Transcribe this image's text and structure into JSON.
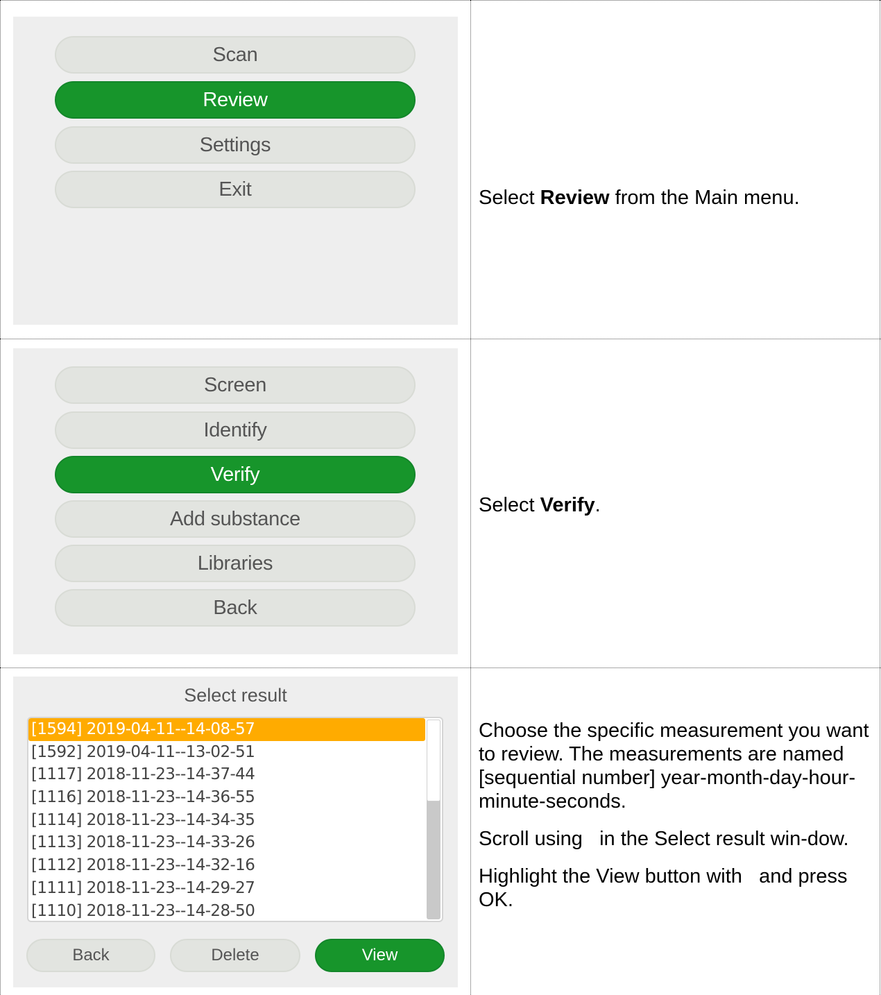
{
  "row1": {
    "menu": [
      "Scan",
      "Review",
      "Settings",
      "Exit"
    ],
    "active_index": 1,
    "caption": {
      "pre": "Select ",
      "bold": "Review",
      "post": " from the Main menu."
    }
  },
  "row2": {
    "menu": [
      "Screen",
      "Identify",
      "Verify",
      "Add substance",
      "Libraries",
      "Back"
    ],
    "active_index": 2,
    "caption": {
      "pre": "Select ",
      "bold": "Verify",
      "post": "."
    }
  },
  "row3": {
    "title": "Select result",
    "items": [
      "[1594] 2019-04-11--14-08-57",
      "[1592] 2019-04-11--13-02-51",
      "[1117] 2018-11-23--14-37-44",
      "[1116] 2018-11-23--14-36-55",
      "[1114] 2018-11-23--14-34-35",
      "[1113] 2018-11-23--14-33-26",
      "[1112] 2018-11-23--14-32-16",
      "[1111] 2018-11-23--14-29-27",
      "[1110] 2018-11-23--14-28-50"
    ],
    "selected_index": 0,
    "buttons": {
      "back": "Back",
      "delete": "Delete",
      "view": "View"
    },
    "captions": [
      "Choose the specific measurement you want to review. The measurements are named [sequential number] year-month-day-hour-minute-seconds.",
      "Scroll using   in the Select result win-dow.",
      "Highlight the View button with   and press OK."
    ]
  }
}
